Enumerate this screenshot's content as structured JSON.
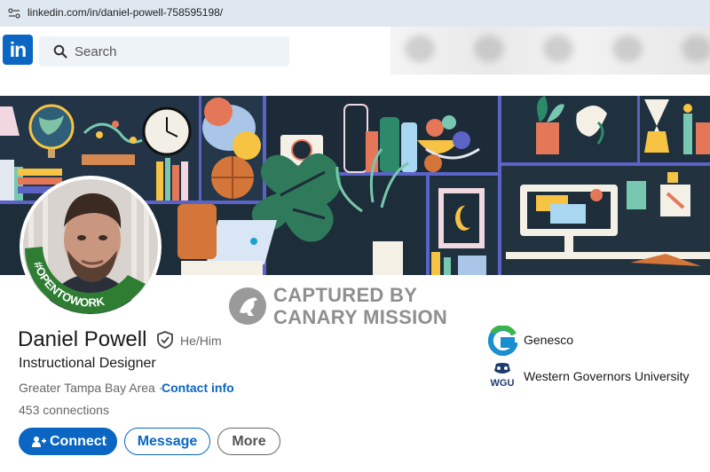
{
  "browser": {
    "url": "linkedin.com/in/daniel-powell-758595198/"
  },
  "nav": {
    "search_placeholder": "Search",
    "logo_text": "in"
  },
  "watermark": {
    "line1": "CAPTURED BY",
    "line2": "CANARY MISSION"
  },
  "avatar": {
    "badge_text": "#OPENTOWORK"
  },
  "profile": {
    "name": "Daniel Powell",
    "pronouns": "He/Him",
    "headline": "Instructional Designer",
    "location": "Greater Tampa Bay Area",
    "separator": "·",
    "contact_label": "Contact info",
    "connections": "453 connections"
  },
  "actions": {
    "connect": "Connect",
    "message": "Message",
    "more": "More"
  },
  "experience": [
    {
      "name": "Genesco",
      "logo_icon": "genesco-logo-icon"
    },
    {
      "name": "Western Governors University",
      "logo_icon": "wgu-logo-icon",
      "logo_text": "WGU"
    }
  ],
  "colors": {
    "brand_blue": "#0a66c2",
    "banner_dark": "#1e2d3a",
    "open_to_work_green": "#2e7d32"
  }
}
